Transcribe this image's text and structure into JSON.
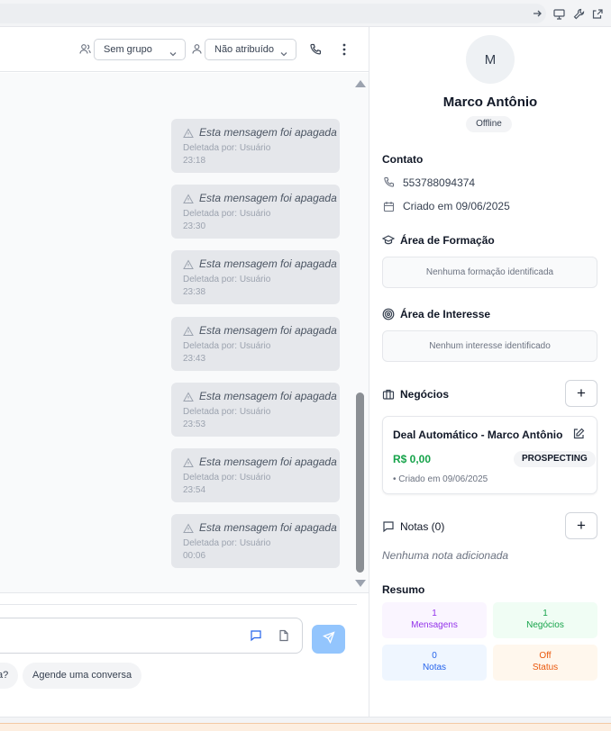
{
  "header": {
    "group_select": "Sem grupo",
    "assignee_select": "Não atribuído"
  },
  "messages": [
    {
      "text": "Esta mensagem foi apagada",
      "deleted_by": "Deletada por: Usuário",
      "time": "23:18"
    },
    {
      "text": "Esta mensagem foi apagada",
      "deleted_by": "Deletada por: Usuário",
      "time": "23:30"
    },
    {
      "text": "Esta mensagem foi apagada",
      "deleted_by": "Deletada por: Usuário",
      "time": "23:38"
    },
    {
      "text": "Esta mensagem foi apagada",
      "deleted_by": "Deletada por: Usuário",
      "time": "23:43"
    },
    {
      "text": "Esta mensagem foi apagada",
      "deleted_by": "Deletada por: Usuário",
      "time": "23:53"
    },
    {
      "text": "Esta mensagem foi apagada",
      "deleted_by": "Deletada por: Usuário",
      "time": "23:54"
    },
    {
      "text": "Esta mensagem foi apagada",
      "deleted_by": "Deletada por: Usuário",
      "time": "00:06"
    }
  ],
  "suggestions": [
    "a?",
    "Agende uma conversa"
  ],
  "contact": {
    "initial": "M",
    "name": "Marco Antônio",
    "status": "Offline",
    "section_contact": "Contato",
    "phone": "553788094374",
    "created": "Criado em 09/06/2025"
  },
  "formation": {
    "title": "Área de Formação",
    "empty": "Nenhuma formação identificada"
  },
  "interest": {
    "title": "Área de Interesse",
    "empty": "Nenhum interesse identificado"
  },
  "deals": {
    "title": "Negócios",
    "add": "+",
    "items": [
      {
        "title": "Deal Automático - Marco Antônio",
        "value": "R$ 0,00",
        "stage": "PROSPECTING",
        "created": "• Criado em 09/06/2025"
      }
    ]
  },
  "notes": {
    "title": "Notas (0)",
    "add": "+",
    "empty": "Nenhuma nota adicionada"
  },
  "summary": {
    "title": "Resumo",
    "stats": [
      {
        "value": "1",
        "label": "Mensagens",
        "bg": "#faf5ff",
        "color": "#9333ea"
      },
      {
        "value": "1",
        "label": "Negócios",
        "bg": "#f0fdf4",
        "color": "#16a34a"
      },
      {
        "value": "0",
        "label": "Notas",
        "bg": "#eff6ff",
        "color": "#2563eb"
      },
      {
        "value": "Off",
        "label": "Status",
        "bg": "#fff7ed",
        "color": "#ea580c"
      }
    ]
  },
  "colors": {
    "send_button": "#93c5fd",
    "deal_value": "#16a34a",
    "scroll_thumb": "#8b8f94"
  }
}
